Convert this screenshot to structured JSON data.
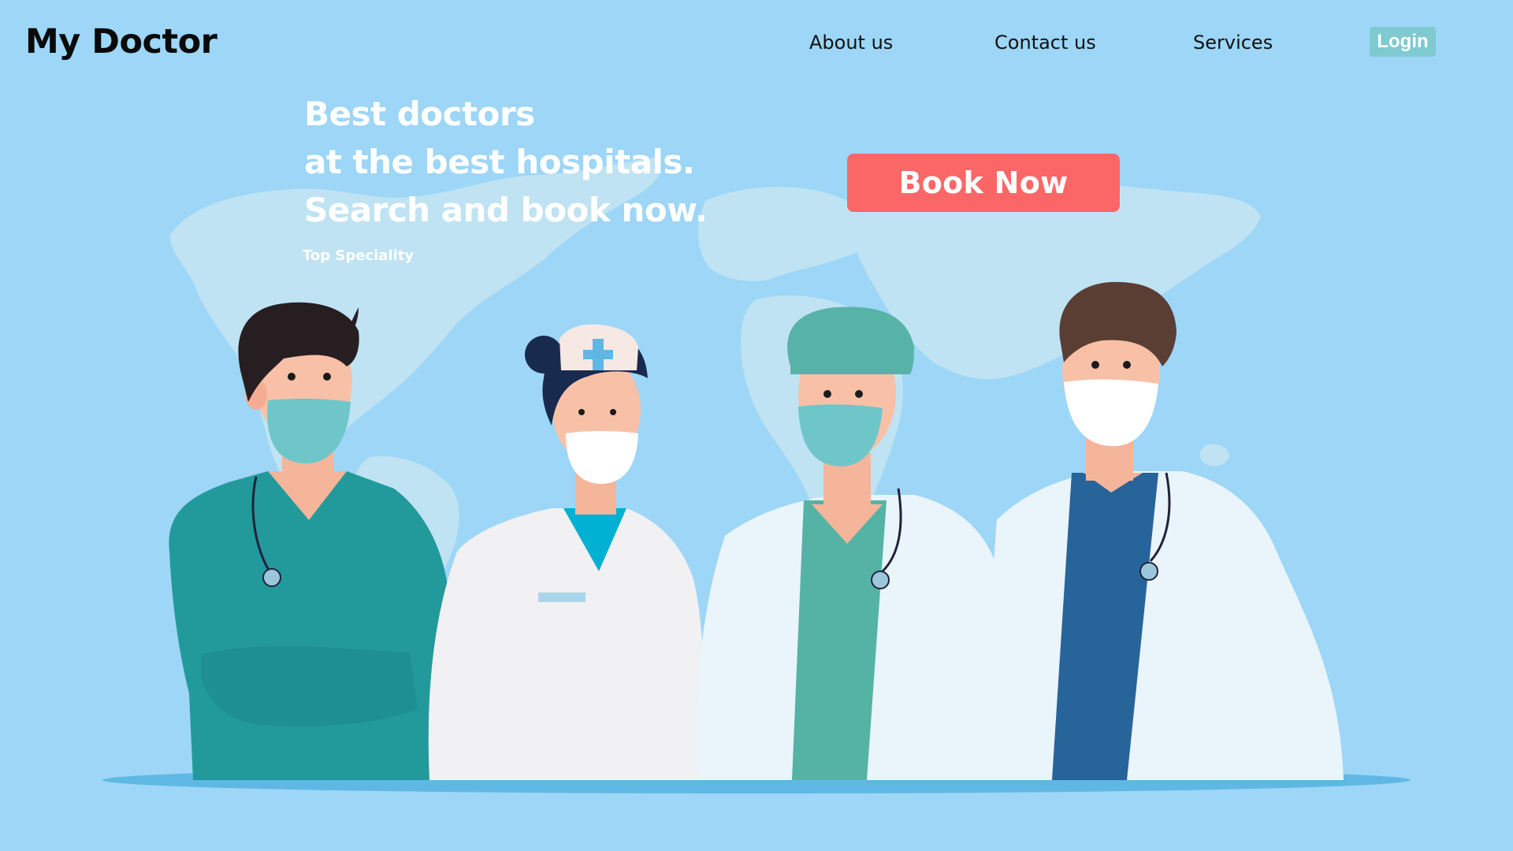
{
  "brand": {
    "name": "My Doctor"
  },
  "nav": {
    "about": "About us",
    "contact": "Contact us",
    "services": "Services",
    "login": "Login"
  },
  "hero": {
    "lines": [
      "Best doctors",
      "at the best hospitals.",
      "Search and book now."
    ],
    "subheading": "Top Speciality",
    "cta": "Book Now"
  },
  "colors": {
    "background": "#9dd6f6",
    "cta": "#fb6767",
    "login": "#7fcad0",
    "map": "#bfe3f3"
  }
}
